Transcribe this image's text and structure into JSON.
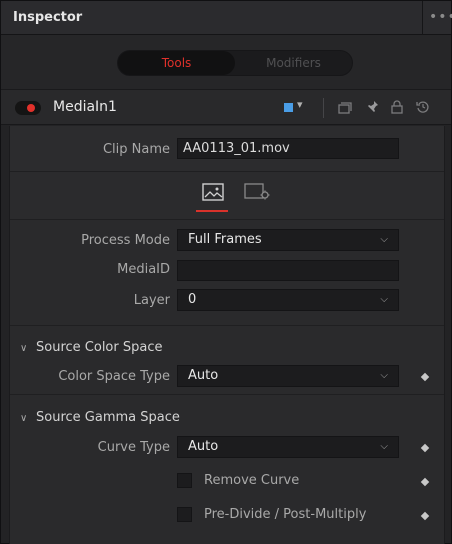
{
  "window": {
    "title": "Inspector",
    "more_icon": "ellipsis-icon"
  },
  "tabs": {
    "tools": "Tools",
    "modifiers": "Modifiers",
    "active": "Tools"
  },
  "node": {
    "name": "MediaIn1",
    "enabled": true,
    "color": "#4a9de6"
  },
  "clip": {
    "label": "Clip Name",
    "value": "AA0113_01.mov"
  },
  "icon_tabs": [
    {
      "icon": "image-icon",
      "active": true
    },
    {
      "icon": "settings-gear-icon",
      "active": false
    }
  ],
  "process": {
    "process_mode_label": "Process Mode",
    "process_mode_value": "Full Frames",
    "media_id_label": "MediaID",
    "media_id_value": "",
    "layer_label": "Layer",
    "layer_value": "0"
  },
  "source_color": {
    "header": "Source Color Space",
    "type_label": "Color Space Type",
    "type_value": "Auto"
  },
  "source_gamma": {
    "header": "Source Gamma Space",
    "curve_label": "Curve Type",
    "curve_value": "Auto",
    "remove_curve": "Remove Curve",
    "predivide": "Pre-Divide / Post-Multiply"
  },
  "colors": {
    "accent": "#e2312b",
    "panel": "#2a2a2c"
  }
}
